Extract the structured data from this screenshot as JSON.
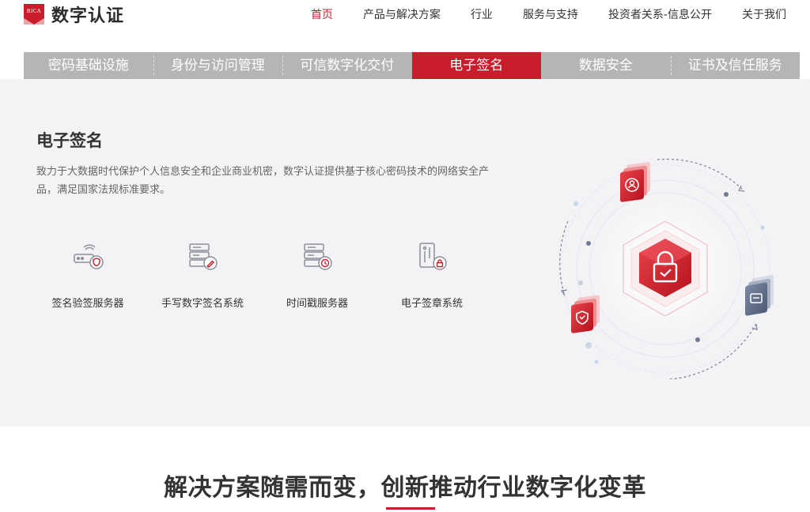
{
  "brand": {
    "badge_text": "BJCA",
    "name": "数字认证",
    "accent_color": "#c81d2b"
  },
  "topnav": [
    {
      "label": "首页",
      "active": true
    },
    {
      "label": "产品与解决方案",
      "active": false
    },
    {
      "label": "行业",
      "active": false
    },
    {
      "label": "服务与支持",
      "active": false
    },
    {
      "label": "投资者关系-信息公开",
      "active": false
    },
    {
      "label": "关于我们",
      "active": false
    }
  ],
  "tabs": [
    {
      "label": "密码基础设施",
      "active": false
    },
    {
      "label": "身份与访问管理",
      "active": false
    },
    {
      "label": "可信数字化交付",
      "active": false
    },
    {
      "label": "电子签名",
      "active": true
    },
    {
      "label": "数据安全",
      "active": false
    },
    {
      "label": "证书及信任服务",
      "active": false
    }
  ],
  "panel": {
    "title": "电子签名",
    "description": "致力于大数据时代保护个人信息安全和企业商业机密，数字认证提供基于核心密码技术的网络安全产品，满足国家法规标准要求。",
    "products": [
      {
        "label": "签名验签服务器",
        "icon": "signature-verify-server-icon"
      },
      {
        "label": "手写数字签名系统",
        "icon": "handwritten-signature-icon"
      },
      {
        "label": "时间戳服务器",
        "icon": "timestamp-server-icon"
      },
      {
        "label": "电子签章系统",
        "icon": "electronic-seal-icon"
      }
    ]
  },
  "section": {
    "heading": "解决方案随需而变，创新推动行业数字化变革"
  },
  "colors": {
    "tab_bg": "#b5b5b5",
    "panel_bg": "#f3f3f5",
    "icon_gray": "#8a8f99",
    "blue_gray": "#5d6b86"
  }
}
